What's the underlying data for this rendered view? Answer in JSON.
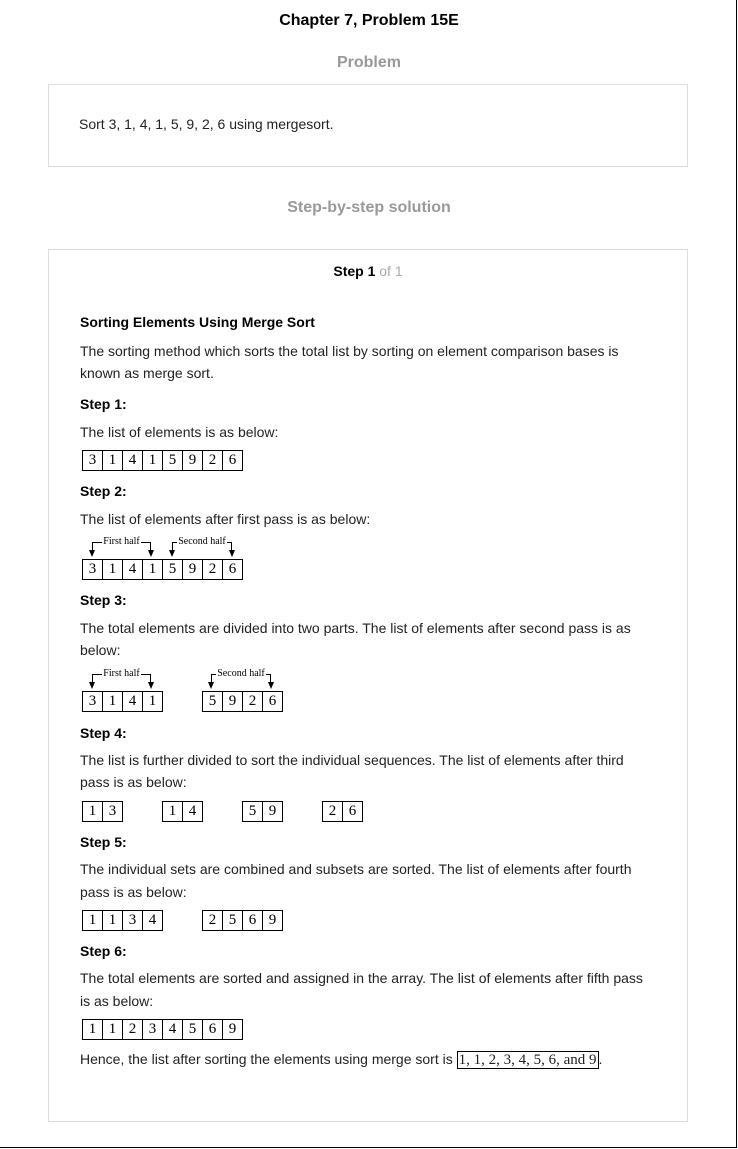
{
  "header": {
    "title": "Chapter 7, Problem 15E"
  },
  "problem": {
    "heading": "Problem",
    "text": "Sort 3, 1, 4, 1, 5, 9, 2, 6 using mergesort."
  },
  "solution": {
    "heading": "Step-by-step solution",
    "step_label": "Step 1",
    "step_of": "of 1",
    "section_title": "Sorting Elements Using Merge Sort",
    "intro_line1": "The sorting method which sorts the total list by sorting on element comparison bases is",
    "intro_line2": "known as merge sort.",
    "steps": [
      {
        "label": "Step 1:",
        "line1": "The list of elements is as below:",
        "line2": ""
      },
      {
        "label": "Step 2:",
        "line1": "The list of elements after first pass is as below:",
        "line2": ""
      },
      {
        "label": "Step 3:",
        "line1": "The total elements are divided into two parts. The list of elements after second pass is as",
        "line2": "below:"
      },
      {
        "label": "Step 4:",
        "line1": "The list is further divided to sort the individual sequences. The list of elements after third",
        "line2": "pass is as below:"
      },
      {
        "label": "Step 5:",
        "line1": "The individual sets are combined and subsets are sorted. The list of elements after fourth",
        "line2": "pass is as below:"
      },
      {
        "label": "Step 6:",
        "line1": "The total elements are sorted and assigned in the array. The list of elements after fifth pass",
        "line2": "is as below:"
      }
    ],
    "bracket_labels": {
      "first_half": "First half",
      "second_half": "Second half"
    },
    "arrays": {
      "step1": [
        "3",
        "1",
        "4",
        "1",
        "5",
        "9",
        "2",
        "6"
      ],
      "step2": [
        "3",
        "1",
        "4",
        "1",
        "5",
        "9",
        "2",
        "6"
      ],
      "step3": [
        [
          "3",
          "1",
          "4",
          "1"
        ],
        [
          "5",
          "9",
          "2",
          "6"
        ]
      ],
      "step4": [
        [
          "1",
          "3"
        ],
        [
          "1",
          "4"
        ],
        [
          "5",
          "9"
        ],
        [
          "2",
          "6"
        ]
      ],
      "step5": [
        [
          "1",
          "1",
          "3",
          "4"
        ],
        [
          "2",
          "5",
          "6",
          "9"
        ]
      ],
      "step6": [
        "1",
        "1",
        "2",
        "3",
        "4",
        "5",
        "6",
        "9"
      ]
    },
    "conclusion_prefix": "Hence, the list after sorting the elements using merge sort is",
    "conclusion_answer": "1, 1, 2, 3, 4, 5, 6, and 9",
    "conclusion_suffix": "."
  }
}
